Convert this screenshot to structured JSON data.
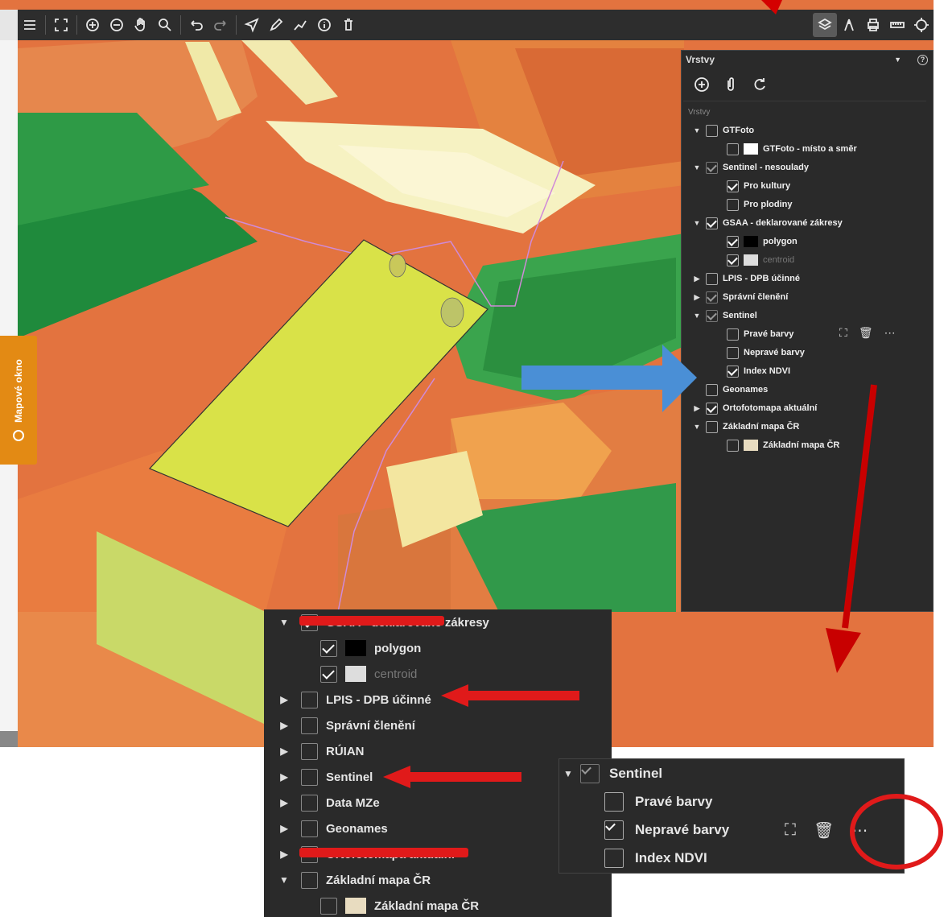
{
  "toolbar": {
    "left_icons": [
      "menu-icon",
      "fullscreen-icon",
      "zoom-in-icon",
      "zoom-out-icon",
      "pan-hand-icon",
      "zoom-box-icon",
      "undo-icon",
      "redo-icon",
      "select-arrow-icon",
      "draw-pencil-icon",
      "measure-line-icon",
      "info-icon",
      "delete-icon"
    ],
    "right_icons": [
      "layers-icon",
      "north-icon",
      "print-icon",
      "ruler-icon",
      "locate-icon"
    ]
  },
  "side_tab": {
    "label": "Mapové okno"
  },
  "panel": {
    "title": "Vrstvy",
    "subtitle": "Vrstvy",
    "rows": [
      {
        "label": "GTFoto"
      },
      {
        "label": "GTFoto - místo a směr"
      },
      {
        "label": "Sentinel - nesoulady"
      },
      {
        "label": "Pro kultury"
      },
      {
        "label": "Pro plodiny"
      },
      {
        "label": "GSAA - deklarované zákresy"
      },
      {
        "label": "polygon"
      },
      {
        "label": "centroid"
      },
      {
        "label": "LPIS - DPB účinné"
      },
      {
        "label": "Správní členění"
      },
      {
        "label": "Sentinel"
      },
      {
        "label": "Pravé barvy"
      },
      {
        "label": "Nepravé barvy"
      },
      {
        "label": "Index NDVI"
      },
      {
        "label": "Geonames"
      },
      {
        "label": "Ortofotomapa aktuální"
      },
      {
        "label": "Základní mapa ČR"
      },
      {
        "label": "Základní mapa ČR"
      }
    ]
  },
  "zoom": {
    "rows": [
      {
        "label": "GSAA - deklarované zákresy"
      },
      {
        "label": "polygon"
      },
      {
        "label": "centroid"
      },
      {
        "label": "LPIS - DPB účinné"
      },
      {
        "label": "Správní členění"
      },
      {
        "label": "RÚIAN"
      },
      {
        "label": "Sentinel"
      },
      {
        "label": "Data MZe"
      },
      {
        "label": "Geonames"
      },
      {
        "label": "Ortofotomapa aktuální"
      },
      {
        "label": "Základní mapa ČR"
      },
      {
        "label": "Základní mapa ČR"
      }
    ]
  },
  "zoom2": {
    "rows": [
      {
        "label": "Sentinel"
      },
      {
        "label": "Pravé barvy"
      },
      {
        "label": "Nepravé barvy"
      },
      {
        "label": "Index NDVI"
      }
    ]
  },
  "colors": {
    "panel_bg": "#2a2a2a",
    "accent_orange": "#e38a14",
    "annotation_red": "#d40000",
    "annotation_blue": "#4a8fd6",
    "field_yellow": "#d8e24a"
  }
}
